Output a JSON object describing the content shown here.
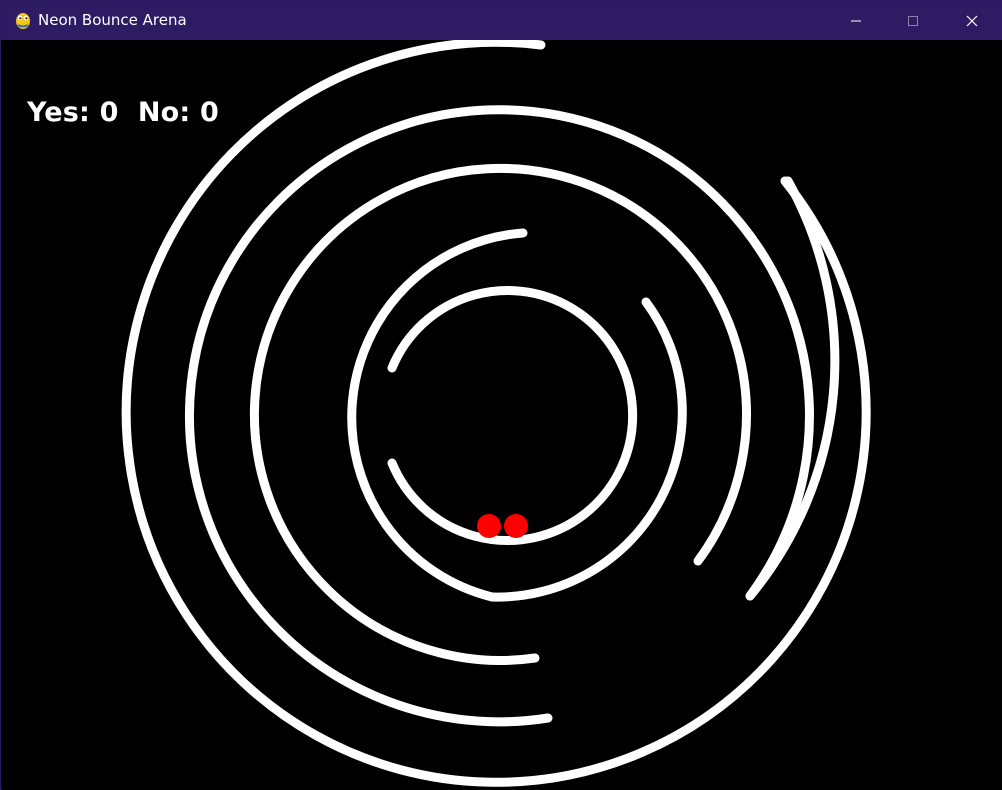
{
  "window": {
    "title": "Neon Bounce Arena",
    "app_icon": "pygame-snake-icon",
    "titlebar_color": "#2d1b64",
    "controls": [
      "minimize-icon",
      "maximize-icon",
      "close-icon"
    ]
  },
  "scoreboard": {
    "yes_label": "Yes:",
    "yes_value": 0,
    "no_label": "No:",
    "no_value": 0,
    "text_color": "#ffffff"
  },
  "arena": {
    "background": "#000000",
    "ring_color": "#ffffff",
    "ball_color": "#ff0000",
    "ball_count": 2
  }
}
